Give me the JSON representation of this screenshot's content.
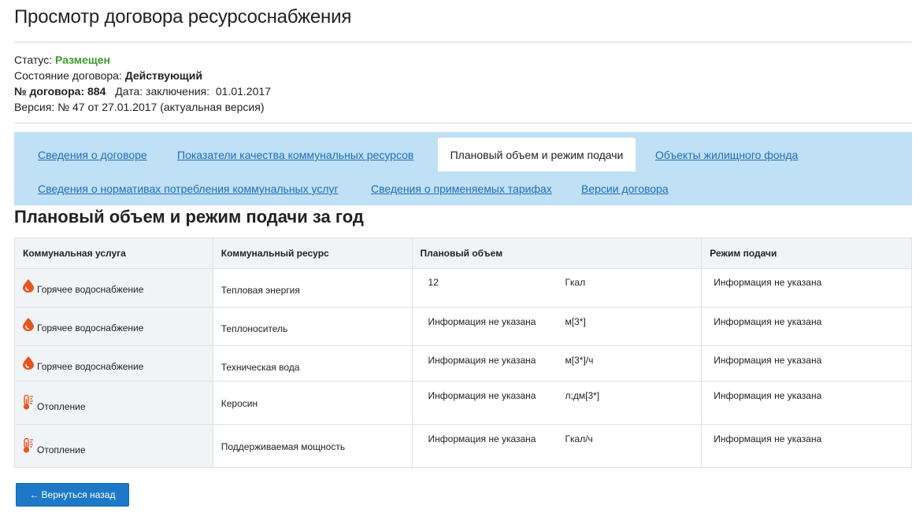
{
  "page": {
    "title": "Просмотр договора ресурсоснабжения"
  },
  "meta": {
    "status_label": "Статус:",
    "status_value": "Размещен",
    "state_label": "Состояние договора:",
    "state_value": "Действующий",
    "number_label": "№ договора:",
    "number_value": "884",
    "date_label": "Дата: заключения:",
    "date_value": "01.01.2017",
    "version_text": "Версия: № 47 от 27.01.2017 (актуальная версия)"
  },
  "tabs": {
    "row1": [
      "Сведения о договоре",
      "Показатели качества коммунальных ресурсов",
      "Плановый объем и режим подачи",
      "Объекты жилищного фонда"
    ],
    "row2": [
      "Сведения о нормативах потребления коммунальных услуг",
      "Сведения о применяемых тарифах",
      "Версии договора"
    ],
    "active": "Плановый объем и режим подачи"
  },
  "section_title": "Плановый объем и режим подачи за год",
  "table": {
    "headers": [
      "Коммунальная услуга",
      "Коммунальный ресурс",
      "Плановый объем",
      "Режим подачи"
    ],
    "rows": [
      {
        "icon": "water-drop-icon",
        "service": "Горячее водоснабжение",
        "resource": "Тепловая энергия",
        "volume": "12",
        "unit": "Гкал",
        "mode": "Информация не указана"
      },
      {
        "icon": "water-drop-icon",
        "service": "Горячее водоснабжение",
        "resource": "Теплоноситель",
        "volume": "Информация не указана",
        "unit": "м[3*]",
        "mode": "Информация не указана"
      },
      {
        "icon": "water-drop-icon",
        "service": "Горячее водоснабжение",
        "resource": "Техническая вода",
        "volume": "Информация не указана",
        "unit": "м[3*]/ч",
        "mode": "Информация не указана"
      },
      {
        "icon": "thermometer-icon",
        "service": "Отопление",
        "resource": "Керосин",
        "volume": "Информация не указана",
        "unit": "л;дм[3*]",
        "mode": "Информация не указана"
      },
      {
        "icon": "thermometer-icon",
        "service": "Отопление",
        "resource": "Поддерживаемая мощность",
        "volume": "Информация не указана",
        "unit": "Гкал/ч",
        "mode": "Информация не указана"
      }
    ]
  },
  "back_button": {
    "arrow": "←",
    "label": "Вернуться назад"
  },
  "colors": {
    "accent": "#1d79c7",
    "tabs_bg": "#c0e0f6",
    "status_green": "#3c9c2b",
    "icon_orange": "#e8541c"
  }
}
